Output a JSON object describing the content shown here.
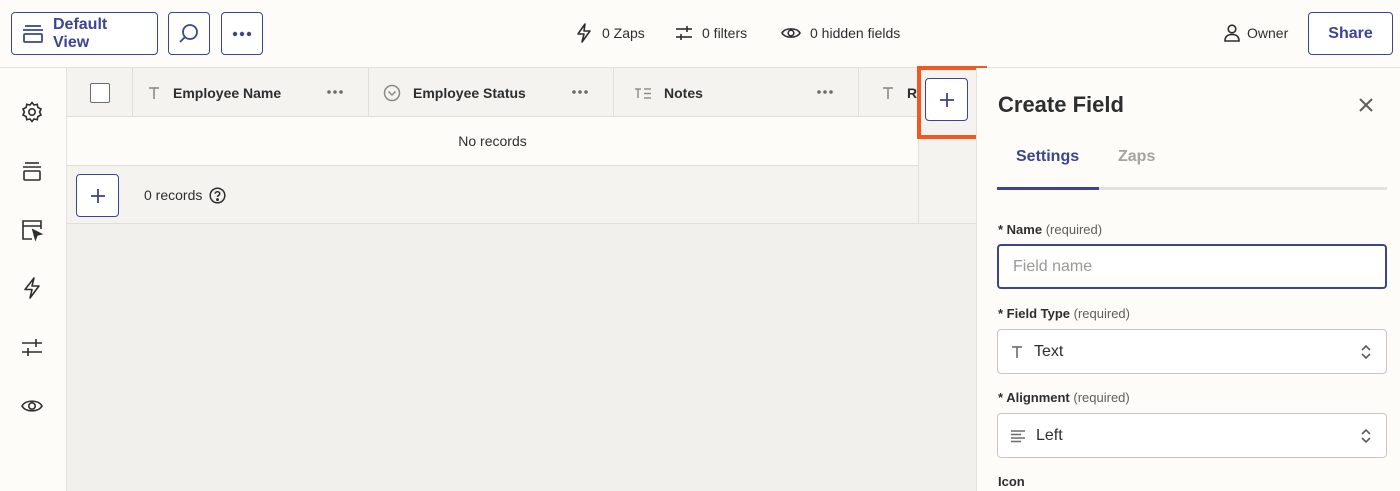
{
  "toolbar": {
    "view_label": "Default View",
    "zaps": "0 Zaps",
    "filters": "0 filters",
    "hidden_fields": "0 hidden fields",
    "owner": "Owner",
    "share_label": "Share"
  },
  "columns": [
    {
      "name": "Employee Name",
      "type_icon": "text-type-icon"
    },
    {
      "name": "Employee Status",
      "type_icon": "status-type-icon"
    },
    {
      "name": "Notes",
      "type_icon": "long-text-type-icon"
    },
    {
      "name": "R",
      "type_icon": "text-type-icon"
    }
  ],
  "table": {
    "empty_message": "No records",
    "record_count": "0 records"
  },
  "panel": {
    "title": "Create Field",
    "tabs": [
      "Settings",
      "Zaps"
    ],
    "name_label": "Name",
    "name_required": "(required)",
    "name_placeholder": "Field name",
    "field_type_label": "Field Type",
    "field_type_required": "(required)",
    "field_type_value": "Text",
    "alignment_label": "Alignment",
    "alignment_required": "(required)",
    "alignment_value": "Left",
    "icon_label": "Icon"
  },
  "colors": {
    "accent": "#3d4592",
    "highlight": "#f05a22",
    "background": "#fdfcf9"
  }
}
